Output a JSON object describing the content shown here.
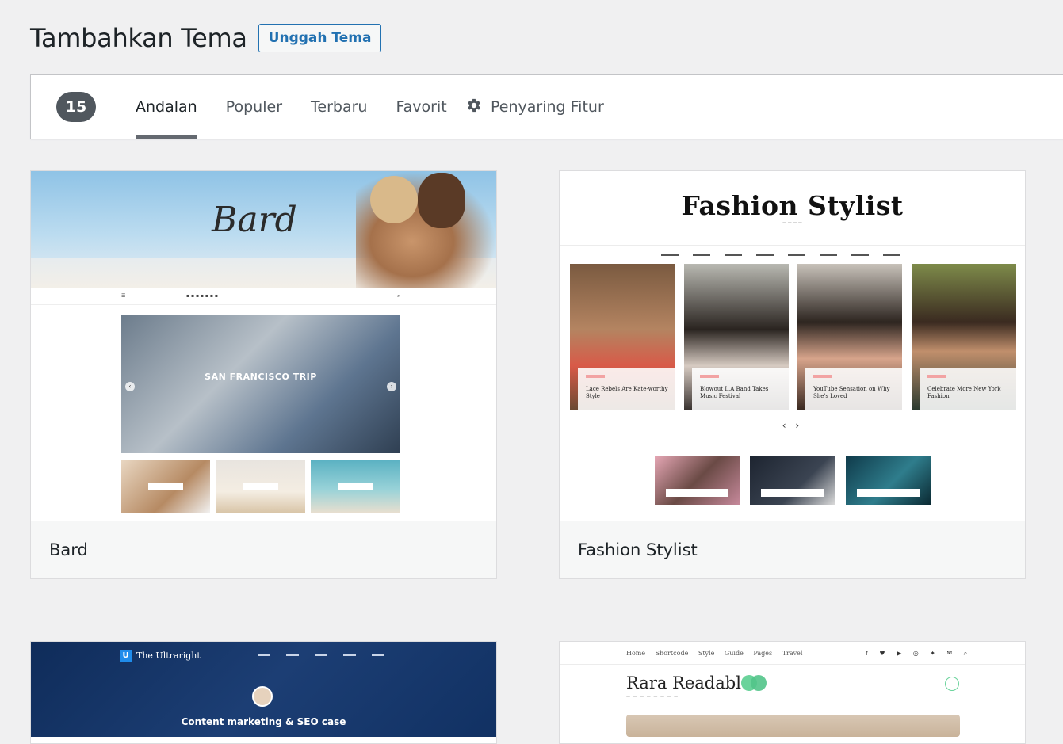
{
  "header": {
    "title": "Tambahkan Tema",
    "upload_label": "Unggah Tema"
  },
  "filter_bar": {
    "count": "15",
    "tabs": [
      {
        "label": "Andalan",
        "active": true
      },
      {
        "label": "Populer",
        "active": false
      },
      {
        "label": "Terbaru",
        "active": false
      },
      {
        "label": "Favorit",
        "active": false
      }
    ],
    "feature_filter_label": "Penyaring Fitur",
    "feature_filter_icon": "gear-icon"
  },
  "themes": [
    {
      "name": "Bard",
      "screenshot": {
        "logo": "Bard",
        "feature_title": "SAN FRANCISCO TRIP"
      }
    },
    {
      "name": "Fashion Stylist",
      "screenshot": {
        "title": "Fashion Stylist",
        "posts": [
          "Lace Rebels Are Kate-worthy Style",
          "Blowout L.A Band Takes Music Festival",
          "YouTube Sensation on Why She's Loved",
          "Celebrate More New York Fashion"
        ]
      }
    },
    {
      "name": "",
      "screenshot": {
        "logo": "The Ultraright",
        "headline": "Content marketing & SEO case"
      }
    },
    {
      "name": "",
      "screenshot": {
        "title": "Rara Readable",
        "nav": "Home Shortcode Style Guide Pages Travel"
      }
    }
  ],
  "colors": {
    "accent": "#2271b1",
    "badge": "#50575e",
    "background": "#f0f0f1"
  }
}
